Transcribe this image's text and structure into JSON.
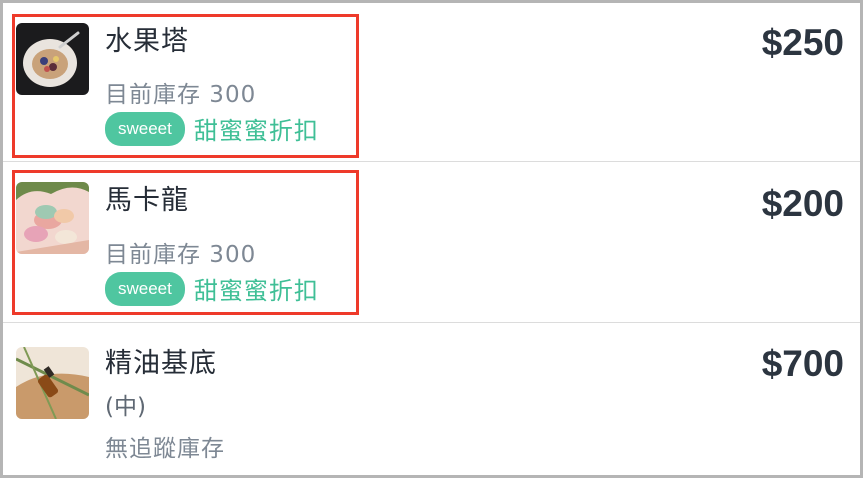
{
  "products": [
    {
      "name": "水果塔",
      "stock": "目前庫存 300",
      "tag": "sweeet",
      "discount": "甜蜜蜜折扣",
      "price": "$250",
      "image_icon": "fruit-tart-image"
    },
    {
      "name": "馬卡龍",
      "stock": "目前庫存 300",
      "tag": "sweeet",
      "discount": "甜蜜蜜折扣",
      "price": "$200",
      "image_icon": "macaron-image"
    },
    {
      "name": "精油基底",
      "variant": "(中)",
      "stock": "無追蹤庫存",
      "price": "$700",
      "image_icon": "essential-oil-image"
    }
  ],
  "colors": {
    "accent": "#4fc6a0",
    "highlight": "#ee3a2a",
    "price": "#2c3540"
  }
}
